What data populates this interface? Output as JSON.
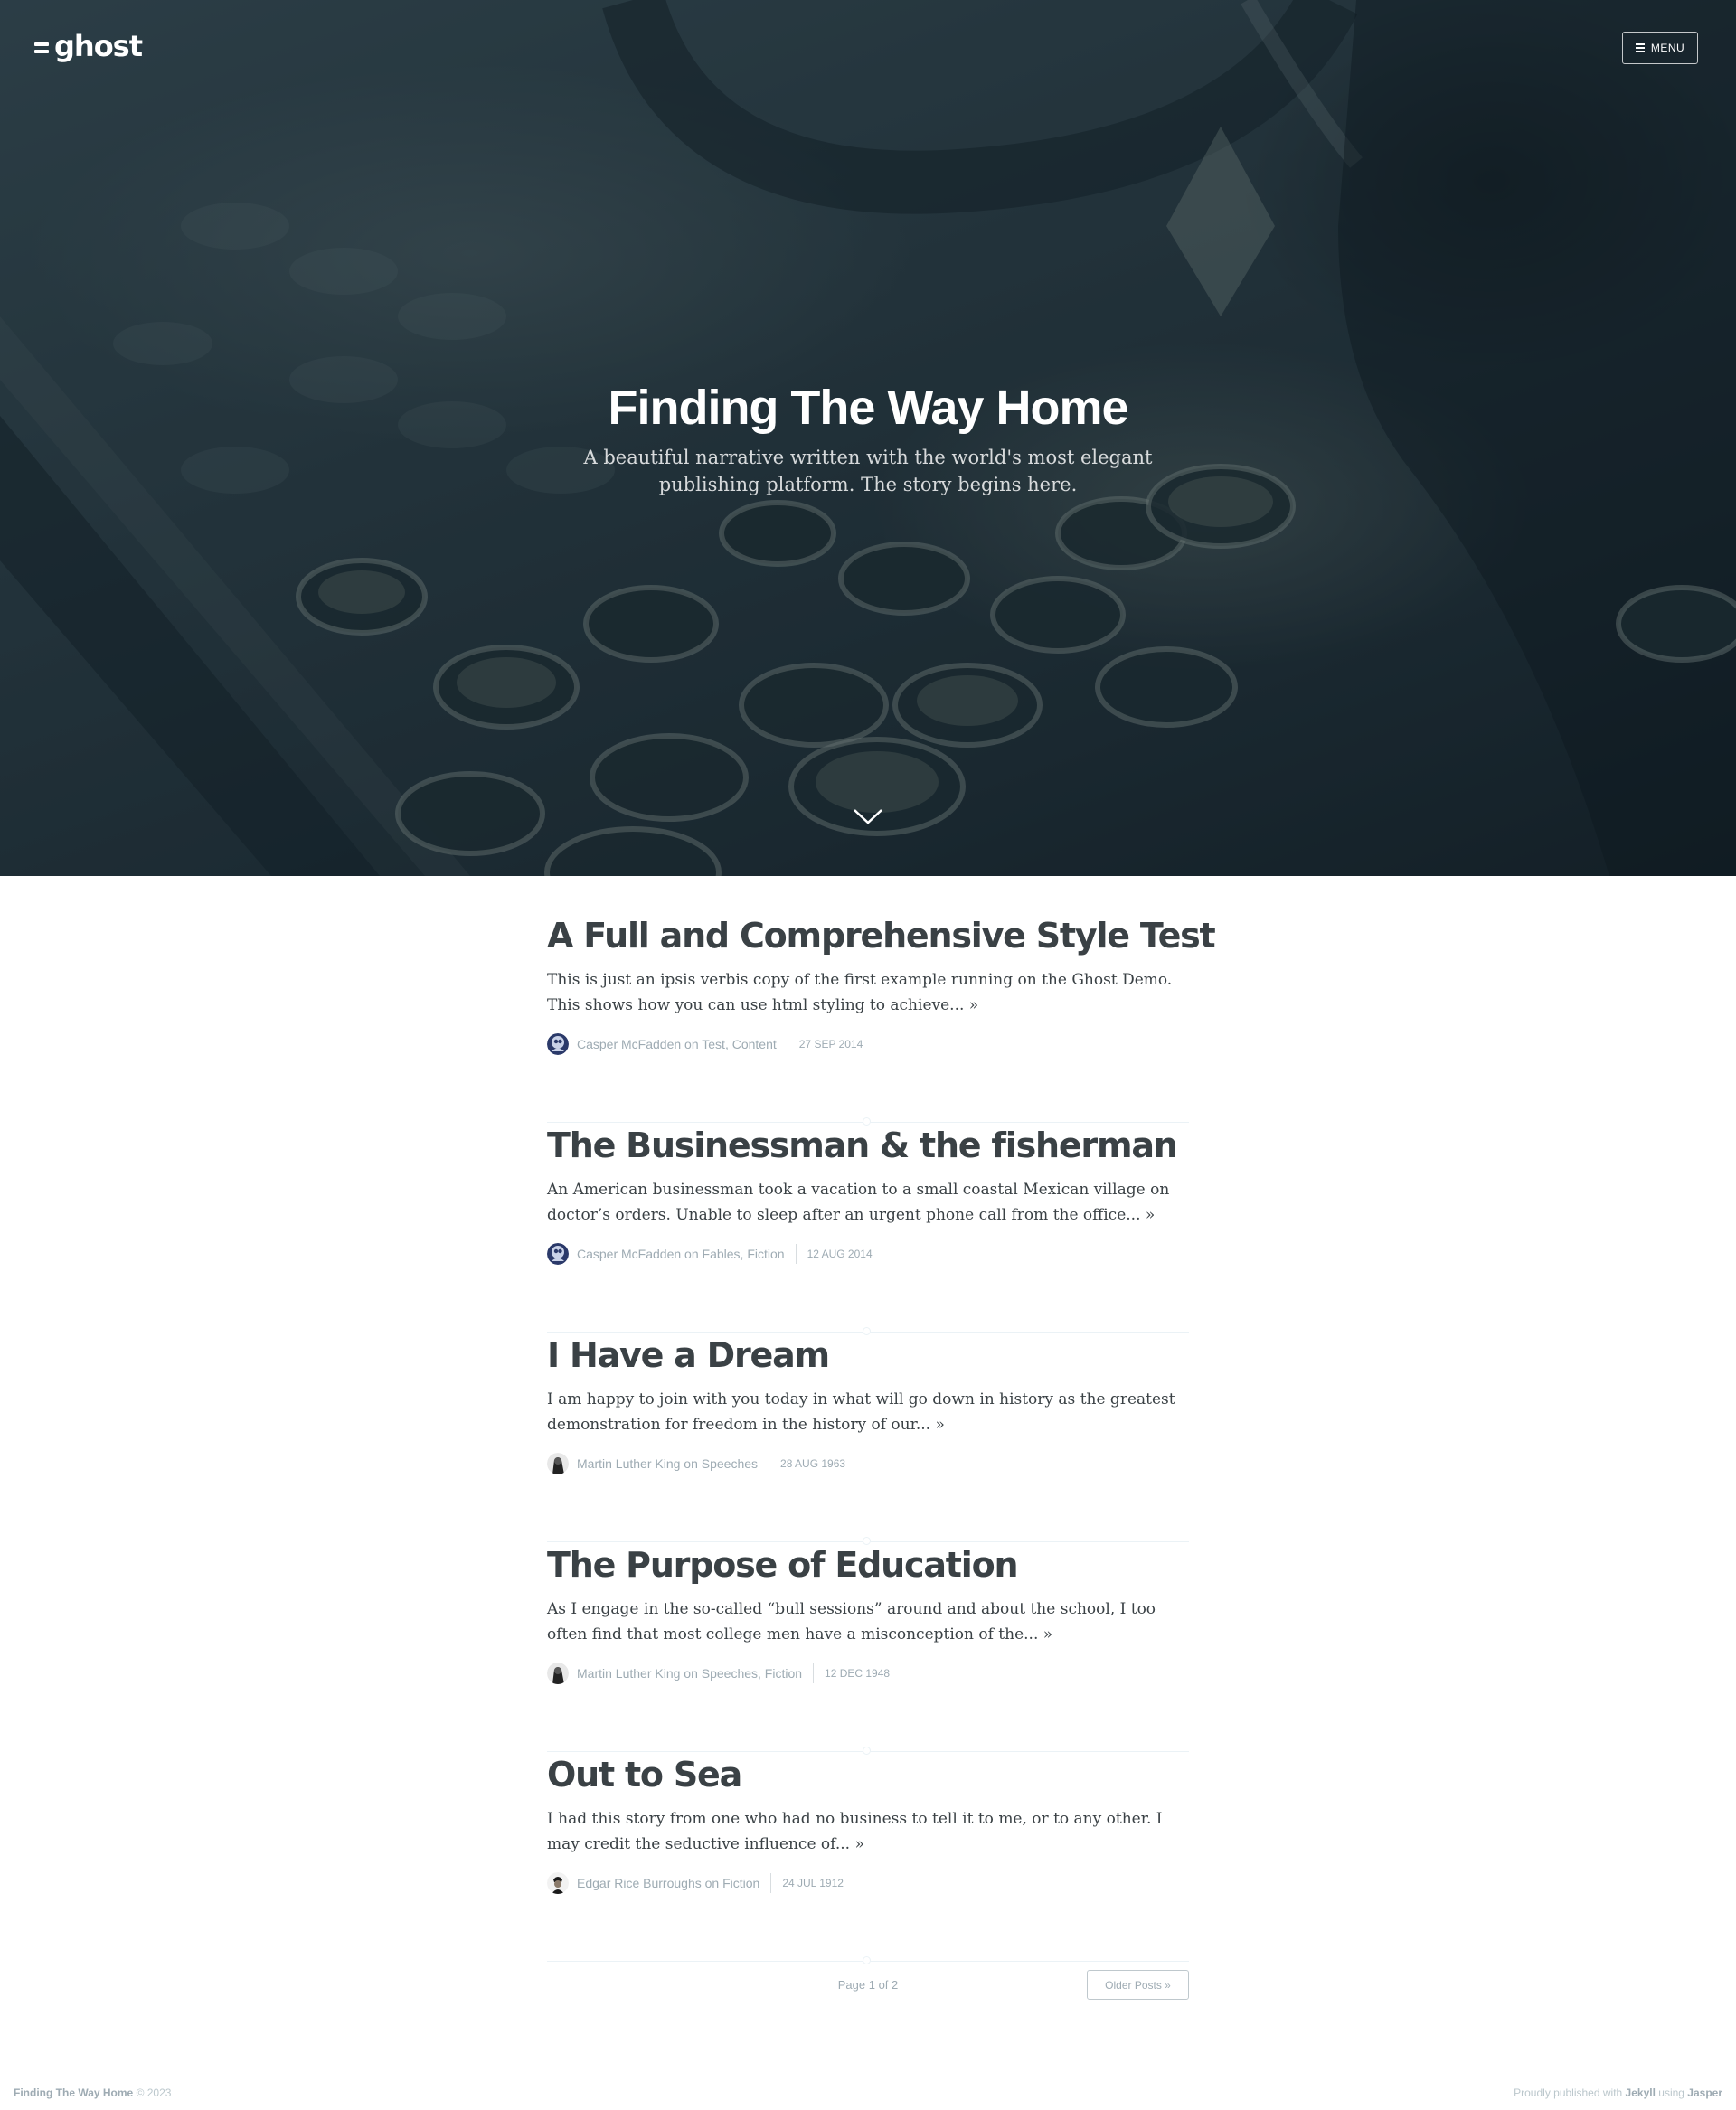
{
  "site": {
    "logo_text": "ghost",
    "menu_label": "MENU",
    "title": "Finding The Way Home",
    "description": "A beautiful narrative written with the world's most elegant publishing platform. The story begins here."
  },
  "posts": [
    {
      "title": "A Full and Comprehensive Style Test",
      "excerpt": "This is just an ipsis verbis copy of the first example running on the Ghost Demo. This shows how you can use html styling to achieve... »",
      "byline": "Casper McFadden on Test, Content",
      "date": "27 SEP 2014",
      "avatar": "casper-avatar"
    },
    {
      "title": "The Businessman & the fisherman",
      "excerpt": "An American businessman took a vacation to a small coastal Mexican village on doctor’s orders. Unable to sleep after an urgent phone call from the office... »",
      "byline": "Casper McFadden on Fables, Fiction",
      "date": "12 AUG 2014",
      "avatar": "casper-avatar"
    },
    {
      "title": "I Have a Dream",
      "excerpt": "I am happy to join with you today in what will go down in history as the greatest demonstration for freedom in the history of our... »",
      "byline": "Martin Luther King on Speeches",
      "date": "28 AUG 1963",
      "avatar": "mlk-avatar"
    },
    {
      "title": "The Purpose of Education",
      "excerpt": "As I engage in the so-called “bull sessions” around and about the school, I too often find that most college men have a misconception of the... »",
      "byline": "Martin Luther King on Speeches, Fiction",
      "date": "12 DEC 1948",
      "avatar": "mlk-avatar"
    },
    {
      "title": "Out to Sea",
      "excerpt": "I had this story from one who had no business to tell it to me, or to any other. I may credit the seductive influence of... »",
      "byline": "Edgar Rice Burroughs on Fiction",
      "date": "24 JUL 1912",
      "avatar": "erb-avatar"
    }
  ],
  "pagination": {
    "page_number": "Page 1 of 2",
    "older_label": "Older Posts »"
  },
  "footer": {
    "site_name": "Finding The Way Home",
    "copyright": "© 2023",
    "published_prefix": "Proudly published with",
    "jekyll": "Jekyll",
    "using": "using",
    "jasper": "Jasper"
  },
  "colors": {
    "heading": "#3a4145",
    "meta": "#9eabb3",
    "hero_overlay": "#122630"
  }
}
